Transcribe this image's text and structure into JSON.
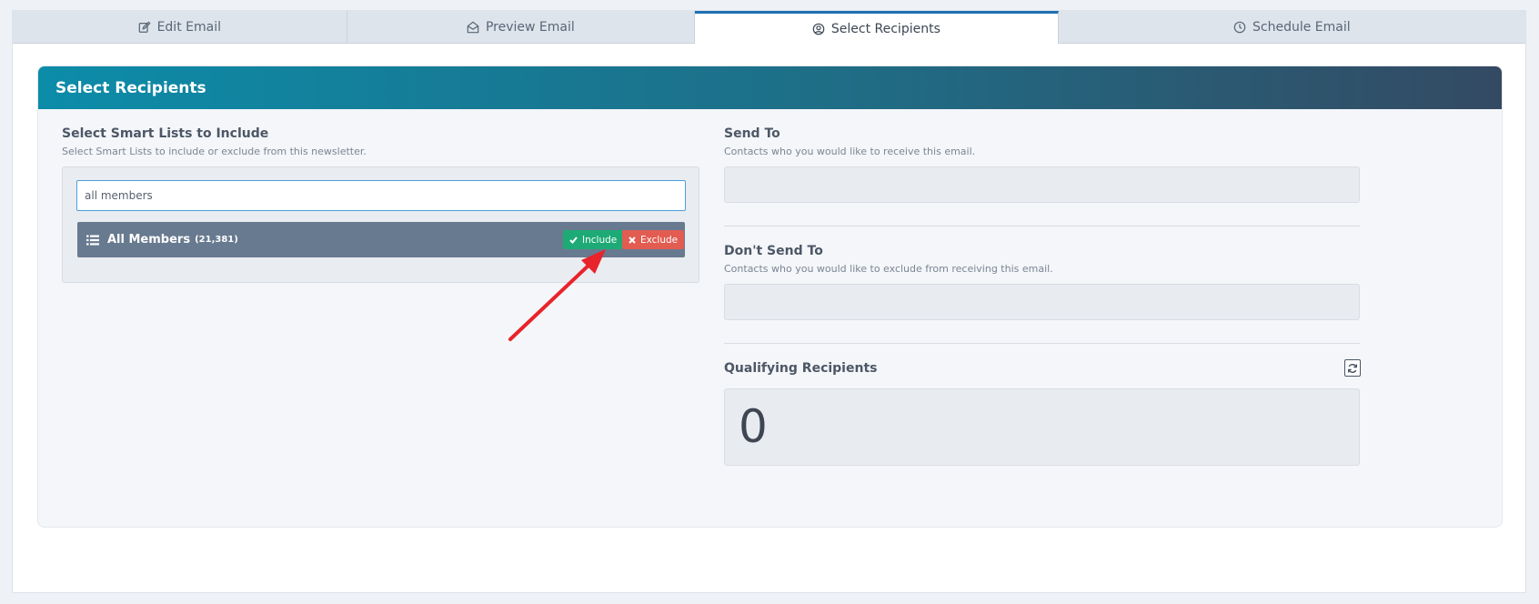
{
  "tabs": [
    {
      "label": "Edit Email",
      "icon": "edit-icon",
      "active": false
    },
    {
      "label": "Preview Email",
      "icon": "envelope-open-icon",
      "active": false
    },
    {
      "label": "Select Recipients",
      "icon": "user-circle-icon",
      "active": true
    },
    {
      "label": "Schedule Email",
      "icon": "clock-icon",
      "active": false
    }
  ],
  "card": {
    "title": "Select Recipients"
  },
  "smart_lists": {
    "title": "Select Smart Lists to Include",
    "description": "Select Smart Lists to include or exclude from this newsletter.",
    "search_value": "all members",
    "results": [
      {
        "name": "All Members",
        "count": "(21,381)",
        "include_label": "Include",
        "exclude_label": "Exclude"
      }
    ]
  },
  "send_to": {
    "title": "Send To",
    "description": "Contacts who you would like to receive this email."
  },
  "dont_send_to": {
    "title": "Don't Send To",
    "description": "Contacts who you would like to exclude from receiving this email."
  },
  "qualifying": {
    "title": "Qualifying Recipients",
    "count": "0"
  },
  "colors": {
    "active_tab_border": "#1e6fb3",
    "header_gradient_start": "#0c8ca9",
    "header_gradient_end": "#344a63",
    "include": "#1eaa76",
    "exclude": "#e25c52",
    "list_row": "#687a8f",
    "annotation_arrow": "#e8232a"
  }
}
